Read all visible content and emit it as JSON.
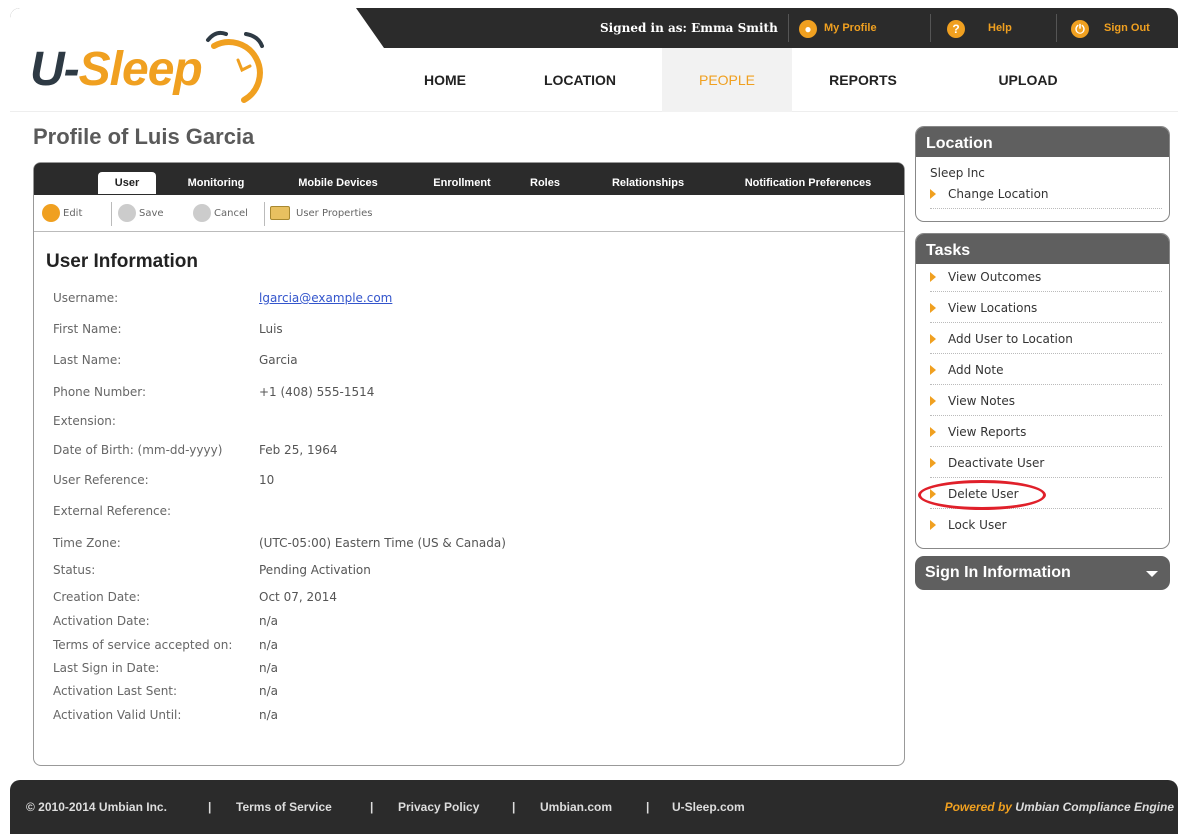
{
  "header": {
    "signed_in": "Signed in as: Emma Smith",
    "my_profile": "My Profile",
    "help": "Help",
    "sign_out": "Sign Out"
  },
  "logo": {
    "prefix": "U-",
    "word": "Sleep"
  },
  "nav": {
    "home": "HOME",
    "location": "LOCATION",
    "people": "PEOPLE",
    "reports": "REPORTS",
    "upload": "UPLOAD"
  },
  "page": {
    "title": "Profile of Luis Garcia"
  },
  "tabs": {
    "user": "User",
    "monitoring": "Monitoring",
    "mobile_devices": "Mobile Devices",
    "enrollment": "Enrollment",
    "roles": "Roles",
    "relationships": "Relationships",
    "notification_preferences": "Notification Preferences"
  },
  "toolbar": {
    "edit": "Edit",
    "save": "Save",
    "cancel": "Cancel",
    "user_properties": "User Properties"
  },
  "user_info": {
    "title": "User Information",
    "rows": [
      {
        "label": "Username:",
        "value": "lgarcia@example.com"
      },
      {
        "label": "First Name:",
        "value": "Luis"
      },
      {
        "label": "Last Name:",
        "value": "Garcia"
      },
      {
        "label": "Phone Number:",
        "value": "+1 (408) 555-1514"
      },
      {
        "label": "Extension:",
        "value": ""
      },
      {
        "label": "Date of Birth: (mm-dd-yyyy)",
        "value": "Feb 25, 1964"
      },
      {
        "label": "User Reference:",
        "value": "10"
      },
      {
        "label": "External Reference:",
        "value": ""
      },
      {
        "label": "Time Zone:",
        "value": "(UTC-05:00) Eastern Time (US & Canada)"
      },
      {
        "label": "Status:",
        "value": "Pending Activation"
      },
      {
        "label": "Creation Date:",
        "value": "Oct 07, 2014"
      },
      {
        "label": "Activation Date:",
        "value": "n/a"
      },
      {
        "label": "Terms of service accepted on:",
        "value": "n/a"
      },
      {
        "label": "Last Sign in Date:",
        "value": "n/a"
      },
      {
        "label": "Activation Last Sent:",
        "value": "n/a"
      },
      {
        "label": "Activation Valid Until:",
        "value": "n/a"
      }
    ]
  },
  "sidebar": {
    "location": {
      "title": "Location",
      "org": "Sleep Inc",
      "change": "Change Location"
    },
    "tasks": {
      "title": "Tasks",
      "items": [
        "View Outcomes",
        "View Locations",
        "Add User to Location",
        "Add Note",
        "View Notes",
        "View Reports",
        "Deactivate User",
        "Delete User",
        "Lock User"
      ]
    },
    "signin": {
      "title": "Sign In Information"
    }
  },
  "footer": {
    "copyright": "© 2010-2014 Umbian Inc.",
    "sep": "|",
    "terms": "Terms of Service",
    "privacy": "Privacy Policy",
    "umbian": "Umbian.com",
    "usleep": "U-Sleep.com",
    "powered_by": "Powered by",
    "engine": "Umbian Compliance Engine"
  },
  "colors": {
    "accent": "#f0a020",
    "dark": "#2b2b2b",
    "panel_head": "#5f5f5f",
    "highlight": "#e0202a"
  }
}
